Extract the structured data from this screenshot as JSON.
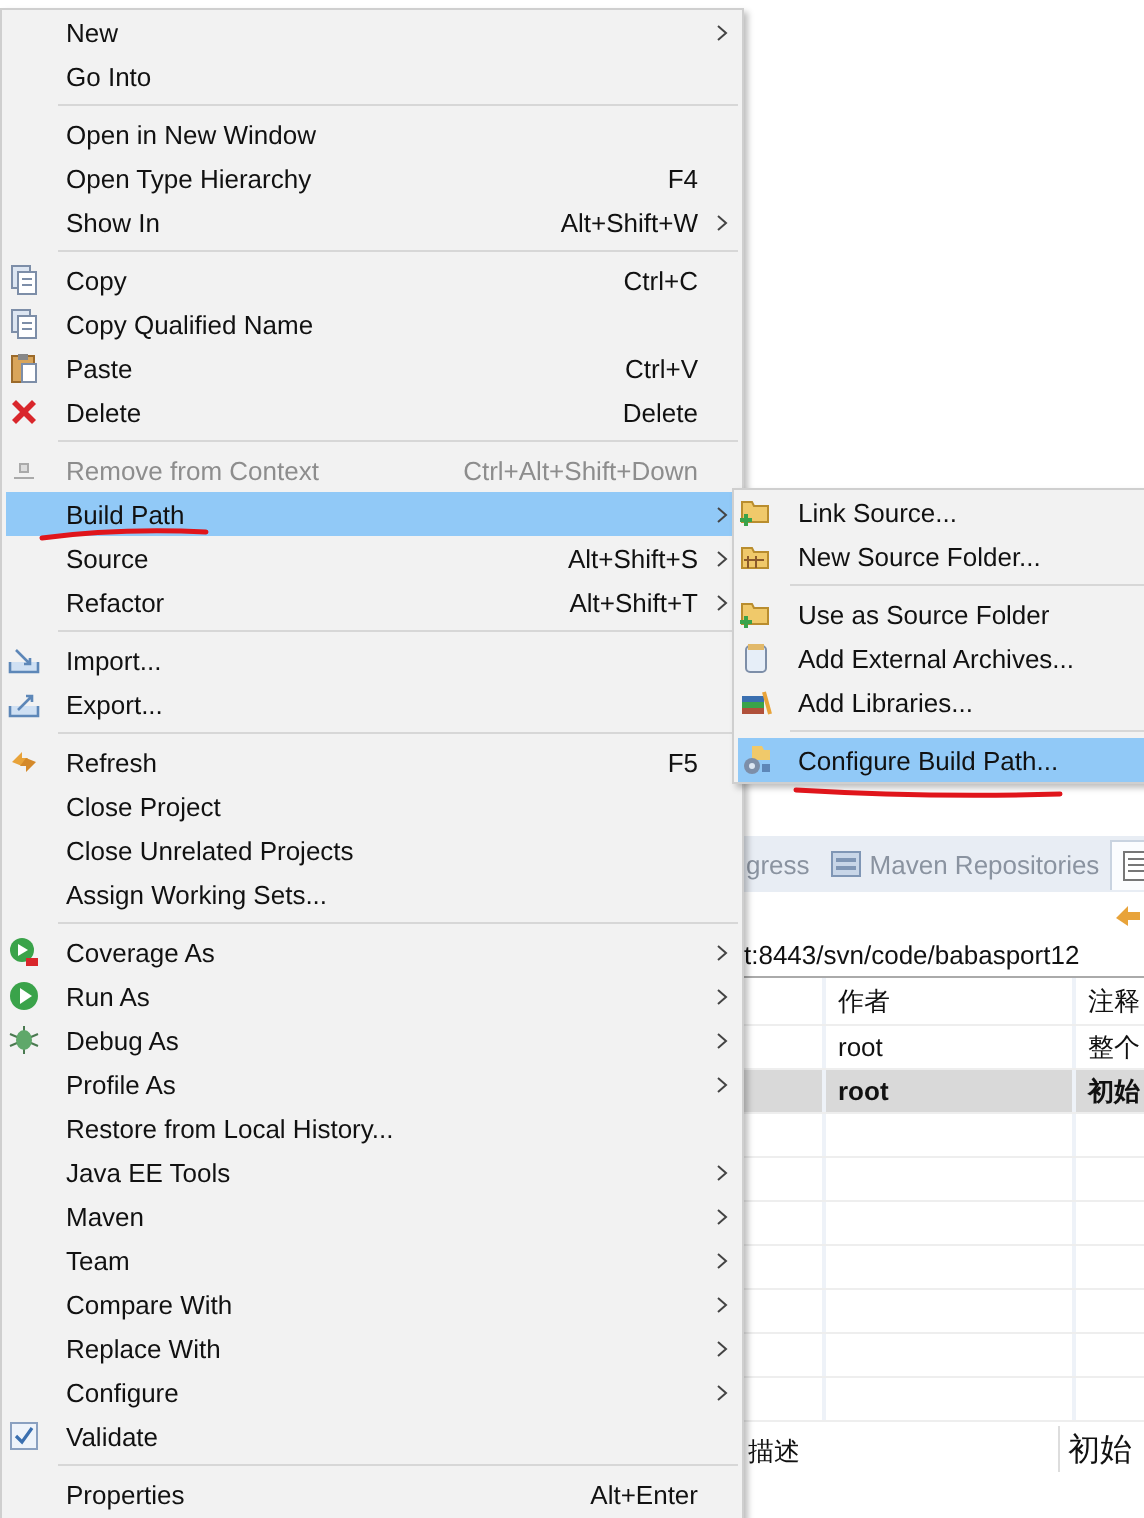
{
  "menu": {
    "items": [
      {
        "kind": "item",
        "label": "New",
        "submenu": true,
        "disabled": false,
        "selected": false,
        "checked": false
      },
      {
        "kind": "item",
        "label": "Go Into",
        "submenu": false,
        "disabled": false,
        "selected": false,
        "checked": false
      },
      {
        "kind": "separator"
      },
      {
        "kind": "item",
        "label": "Open in New Window",
        "submenu": false,
        "disabled": false,
        "selected": false,
        "checked": false
      },
      {
        "kind": "item",
        "label": "Open Type Hierarchy",
        "shortcut": "F4",
        "submenu": false,
        "disabled": false,
        "selected": false,
        "checked": false
      },
      {
        "kind": "item",
        "label": "Show In",
        "shortcut": "Alt+Shift+W",
        "submenu": true,
        "disabled": false,
        "selected": false,
        "checked": false
      },
      {
        "kind": "separator"
      },
      {
        "kind": "item",
        "label": "Copy",
        "shortcut": "Ctrl+C",
        "submenu": false,
        "disabled": false,
        "selected": false,
        "checked": false
      },
      {
        "kind": "item",
        "label": "Copy Qualified Name",
        "submenu": false,
        "disabled": false,
        "selected": false,
        "checked": false
      },
      {
        "kind": "item",
        "label": "Paste",
        "shortcut": "Ctrl+V",
        "submenu": false,
        "disabled": false,
        "selected": false,
        "checked": false
      },
      {
        "kind": "item",
        "label": "Delete",
        "shortcut": "Delete",
        "submenu": false,
        "disabled": false,
        "selected": false,
        "checked": false
      },
      {
        "kind": "separator"
      },
      {
        "kind": "item",
        "label": "Remove from Context",
        "shortcut": "Ctrl+Alt+Shift+Down",
        "submenu": false,
        "disabled": true,
        "selected": false,
        "checked": false
      },
      {
        "kind": "item",
        "label": "Build Path",
        "submenu": true,
        "disabled": false,
        "selected": true,
        "checked": false
      },
      {
        "kind": "item",
        "label": "Source",
        "shortcut": "Alt+Shift+S",
        "submenu": true,
        "disabled": false,
        "selected": false,
        "checked": false
      },
      {
        "kind": "item",
        "label": "Refactor",
        "shortcut": "Alt+Shift+T",
        "submenu": true,
        "disabled": false,
        "selected": false,
        "checked": false
      },
      {
        "kind": "separator"
      },
      {
        "kind": "item",
        "label": "Import...",
        "submenu": false,
        "disabled": false,
        "selected": false,
        "checked": false
      },
      {
        "kind": "item",
        "label": "Export...",
        "submenu": false,
        "disabled": false,
        "selected": false,
        "checked": false
      },
      {
        "kind": "separator"
      },
      {
        "kind": "item",
        "label": "Refresh",
        "shortcut": "F5",
        "submenu": false,
        "disabled": false,
        "selected": false,
        "checked": false
      },
      {
        "kind": "item",
        "label": "Close Project",
        "submenu": false,
        "disabled": false,
        "selected": false,
        "checked": false
      },
      {
        "kind": "item",
        "label": "Close Unrelated Projects",
        "submenu": false,
        "disabled": false,
        "selected": false,
        "checked": false
      },
      {
        "kind": "item",
        "label": "Assign Working Sets...",
        "submenu": false,
        "disabled": false,
        "selected": false,
        "checked": false
      },
      {
        "kind": "separator"
      },
      {
        "kind": "item",
        "label": "Coverage As",
        "submenu": true,
        "disabled": false,
        "selected": false,
        "checked": false
      },
      {
        "kind": "item",
        "label": "Run As",
        "submenu": true,
        "disabled": false,
        "selected": false,
        "checked": false
      },
      {
        "kind": "item",
        "label": "Debug As",
        "submenu": true,
        "disabled": false,
        "selected": false,
        "checked": false
      },
      {
        "kind": "item",
        "label": "Profile As",
        "submenu": true,
        "disabled": false,
        "selected": false,
        "checked": false
      },
      {
        "kind": "item",
        "label": "Restore from Local History...",
        "submenu": false,
        "disabled": false,
        "selected": false,
        "checked": false
      },
      {
        "kind": "item",
        "label": "Java EE Tools",
        "submenu": true,
        "disabled": false,
        "selected": false,
        "checked": false
      },
      {
        "kind": "item",
        "label": "Maven",
        "submenu": true,
        "disabled": false,
        "selected": false,
        "checked": false
      },
      {
        "kind": "item",
        "label": "Team",
        "submenu": true,
        "disabled": false,
        "selected": false,
        "checked": false
      },
      {
        "kind": "item",
        "label": "Compare With",
        "submenu": true,
        "disabled": false,
        "selected": false,
        "checked": false
      },
      {
        "kind": "item",
        "label": "Replace With",
        "submenu": true,
        "disabled": false,
        "selected": false,
        "checked": false
      },
      {
        "kind": "item",
        "label": "Configure",
        "submenu": true,
        "disabled": false,
        "selected": false,
        "checked": false
      },
      {
        "kind": "item",
        "label": "Validate",
        "submenu": false,
        "disabled": false,
        "selected": false,
        "checked": true
      },
      {
        "kind": "separator"
      },
      {
        "kind": "item",
        "label": "Properties",
        "shortcut": "Alt+Enter",
        "submenu": false,
        "disabled": false,
        "selected": false,
        "checked": false
      }
    ]
  },
  "submenu": {
    "items": [
      {
        "kind": "item",
        "label": "Link Source...",
        "selected": false
      },
      {
        "kind": "item",
        "label": "New Source Folder...",
        "selected": false
      },
      {
        "kind": "separator"
      },
      {
        "kind": "item",
        "label": "Use as Source Folder",
        "selected": false
      },
      {
        "kind": "item",
        "label": "Add External Archives...",
        "selected": false
      },
      {
        "kind": "item",
        "label": "Add Libraries...",
        "selected": false
      },
      {
        "kind": "separator"
      },
      {
        "kind": "item",
        "label": "Configure Build Path...",
        "selected": true
      }
    ]
  },
  "panel": {
    "tabs": [
      {
        "label": "gress",
        "selected": false
      },
      {
        "label": "Maven Repositories",
        "selected": false
      },
      {
        "selected": true
      }
    ],
    "url": "t:8443/svn/code/babasport12",
    "table": {
      "columns": [
        "作者",
        "注释"
      ],
      "rows": [
        {
          "cells": [
            "root",
            "整个"
          ],
          "selected": false
        },
        {
          "cells": [
            "root",
            "初始"
          ],
          "selected": true
        }
      ]
    },
    "details": {
      "label": "描述",
      "value": "初始"
    }
  }
}
